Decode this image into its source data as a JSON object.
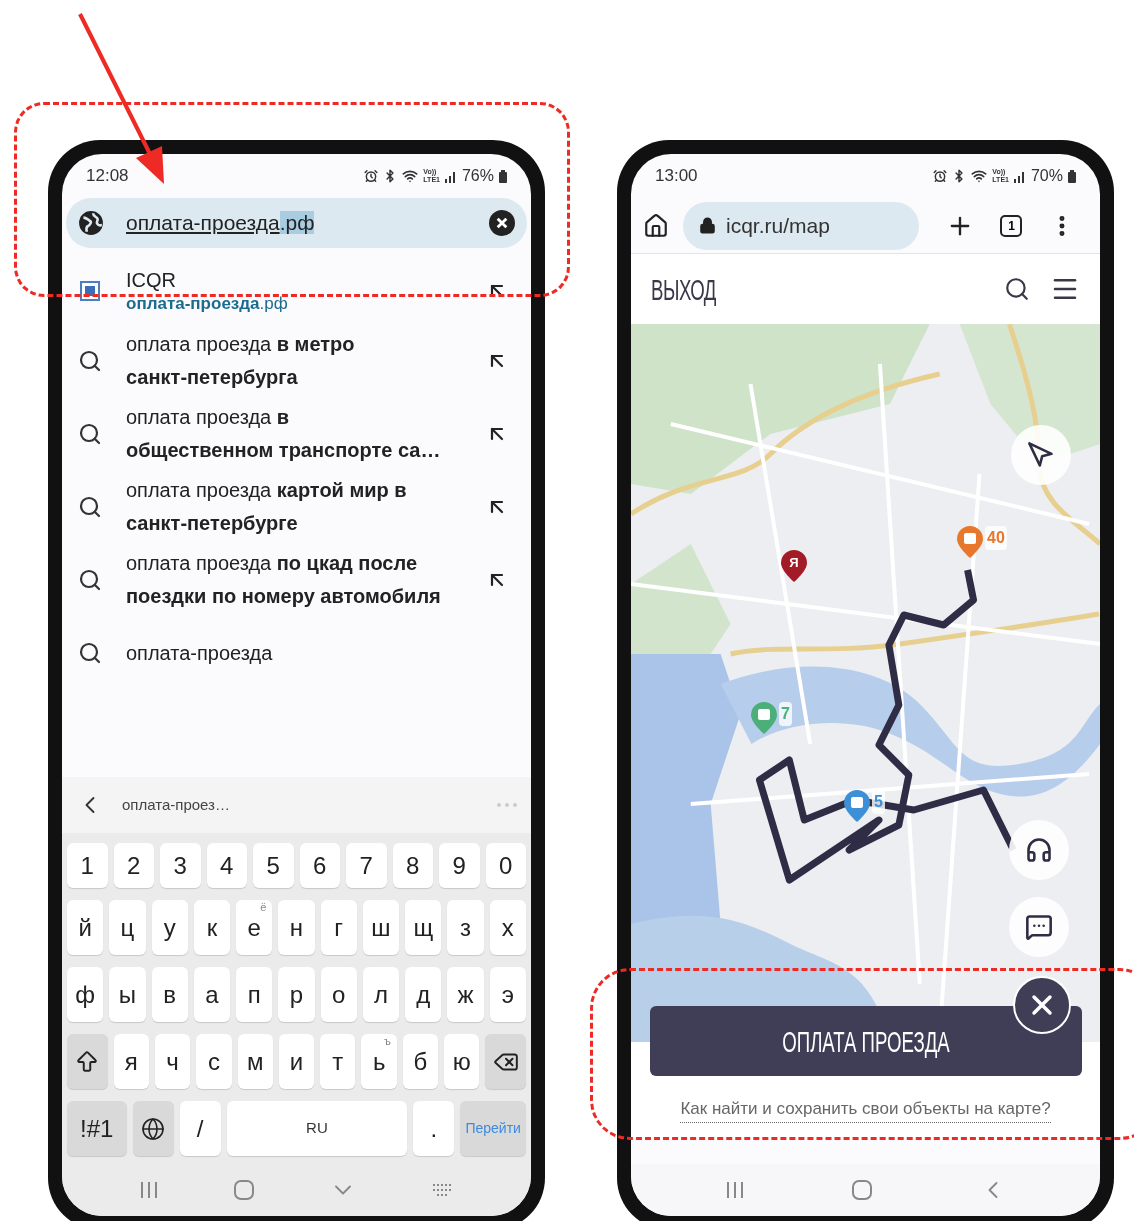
{
  "left_phone": {
    "status_bar": {
      "time": "12:08",
      "network": [
        "Vo))",
        "LTE1"
      ],
      "battery": "76%"
    },
    "address_bar": {
      "value": "оплата-проезда",
      "completion": ".рф"
    },
    "suggestions": [
      {
        "kind": "site",
        "title": "ICQR",
        "subtitle": "**оплата-проезда**.рф"
      },
      {
        "kind": "search",
        "text": "оплата проезда **в метро**\n**санкт-петербурга**"
      },
      {
        "kind": "search",
        "text": "оплата проезда **в**\n**общественном транспорте са…**"
      },
      {
        "kind": "search",
        "text": "оплата проезда **картой мир в**\n**санкт-петербурге**"
      },
      {
        "kind": "search",
        "text": "оплата проезда **по цкад после**\n**поездки по номеру автомобиля**"
      },
      {
        "kind": "query",
        "text": "оплата-проезда"
      }
    ],
    "keyboard": {
      "suggestion": "оплата-проез…",
      "rows": [
        {
          "keys": [
            {
              "kind": "key",
              "label": "1"
            },
            {
              "kind": "key",
              "label": "2"
            },
            {
              "kind": "key",
              "label": "3"
            },
            {
              "kind": "key",
              "label": "4"
            },
            {
              "kind": "key",
              "label": "5"
            },
            {
              "kind": "key",
              "label": "6"
            },
            {
              "kind": "key",
              "label": "7"
            },
            {
              "kind": "key",
              "label": "8"
            },
            {
              "kind": "key",
              "label": "9"
            },
            {
              "kind": "key",
              "label": "0"
            }
          ]
        },
        {
          "keys": [
            {
              "kind": "key",
              "label": "й"
            },
            {
              "kind": "key",
              "label": "ц"
            },
            {
              "kind": "key",
              "label": "у"
            },
            {
              "kind": "key",
              "label": "к"
            },
            {
              "kind": "key",
              "label": "е",
              "hint": "ё"
            },
            {
              "kind": "key",
              "label": "н"
            },
            {
              "kind": "key",
              "label": "г"
            },
            {
              "kind": "key",
              "label": "ш"
            },
            {
              "kind": "key",
              "label": "щ"
            },
            {
              "kind": "key",
              "label": "з"
            },
            {
              "kind": "key",
              "label": "х"
            }
          ]
        },
        {
          "keys": [
            {
              "kind": "key",
              "label": "ф"
            },
            {
              "kind": "key",
              "label": "ы"
            },
            {
              "kind": "key",
              "label": "в"
            },
            {
              "kind": "key",
              "label": "а"
            },
            {
              "kind": "key",
              "label": "п"
            },
            {
              "kind": "key",
              "label": "р"
            },
            {
              "kind": "key",
              "label": "о"
            },
            {
              "kind": "key",
              "label": "л"
            },
            {
              "kind": "key",
              "label": "д"
            },
            {
              "kind": "key",
              "label": "ж"
            },
            {
              "kind": "key",
              "label": "э"
            }
          ]
        },
        {
          "keys": [
            {
              "kind": "shift"
            },
            {
              "kind": "key",
              "label": "я"
            },
            {
              "kind": "key",
              "label": "ч"
            },
            {
              "kind": "key",
              "label": "с"
            },
            {
              "kind": "key",
              "label": "м"
            },
            {
              "kind": "key",
              "label": "и"
            },
            {
              "kind": "key",
              "label": "т"
            },
            {
              "kind": "key",
              "label": "ь",
              "hint": "ъ"
            },
            {
              "kind": "key",
              "label": "б"
            },
            {
              "kind": "key",
              "label": "ю"
            },
            {
              "kind": "backspace"
            }
          ]
        },
        {
          "keys": [
            {
              "kind": "function",
              "label": "!#1"
            },
            {
              "kind": "globe"
            },
            {
              "kind": "key",
              "label": "/"
            },
            {
              "kind": "space",
              "label": "RU"
            },
            {
              "kind": "key",
              "label": "."
            },
            {
              "kind": "go",
              "label": "Перейти"
            }
          ]
        }
      ]
    }
  },
  "right_phone": {
    "status_bar": {
      "time": "13:00",
      "network": [
        "Vo))",
        "LTE1"
      ],
      "battery": "70%"
    },
    "url": "icqr.ru/map",
    "tab_count": "1",
    "site_logo": "ВЫХОД",
    "map": {
      "kind": "picture",
      "markers": [
        {
          "label": "40",
          "color": "#e8772e"
        },
        {
          "label": "Я",
          "color": "#a31b26"
        },
        {
          "label": "7",
          "color": "#4caf7a"
        },
        {
          "label": "5",
          "color": "#3d8fd6"
        }
      ]
    },
    "pay_button": "ОПЛАТА ПРОЕЗДА",
    "help_link": "Как найти и сохранить свои объекты на карте?"
  }
}
